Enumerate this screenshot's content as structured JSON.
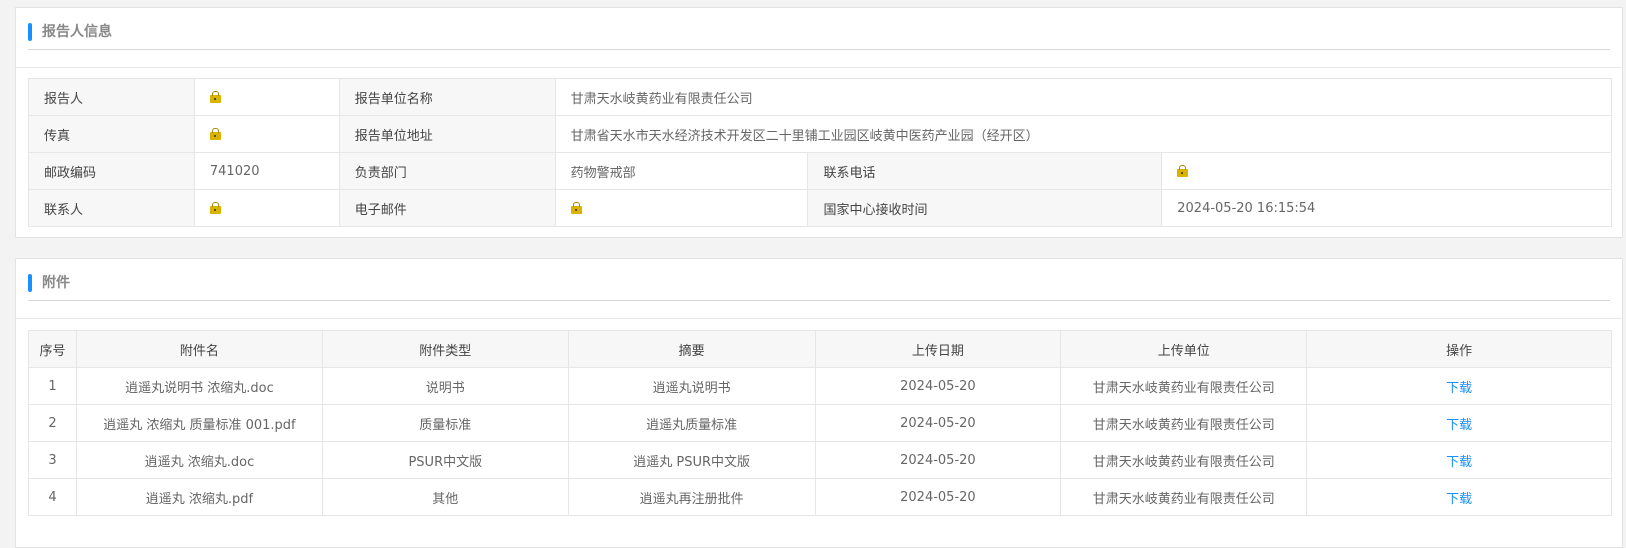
{
  "reporter_section": {
    "title": "报告人信息",
    "rows": [
      {
        "l1": "报告人",
        "v1": "",
        "l2": "报告单位名称",
        "v2": "甘肃天水岐黄药业有限责任公司"
      },
      {
        "l1": "传真",
        "v1": "",
        "l2": "报告单位地址",
        "v2": "甘肃省天水市天水经济技术开发区二十里铺工业园区岐黄中医药产业园（经开区）"
      },
      {
        "l1": "邮政编码",
        "v1": "741020",
        "l2": "负责部门",
        "v2": "药物警戒部",
        "l3": "联系电话",
        "v3": ""
      },
      {
        "l1": "联系人",
        "v1": "",
        "l2": "电子邮件",
        "v2": "",
        "l3": "国家中心接收时间",
        "v3": "2024-05-20 16:15:54"
      }
    ],
    "hidden_value_icon": "lock-icon"
  },
  "attachment_section": {
    "title": "附件",
    "columns": [
      "序号",
      "附件名",
      "附件类型",
      "摘要",
      "上传日期",
      "上传单位",
      "操作"
    ],
    "rows": [
      {
        "no": "1",
        "name": "逍遥丸说明书 浓缩丸.doc",
        "type": "说明书",
        "summary": "逍遥丸说明书",
        "date": "2024-05-20",
        "unit": "甘肃天水岐黄药业有限责任公司",
        "action": "下载"
      },
      {
        "no": "2",
        "name": "逍遥丸 浓缩丸 质量标准 001.pdf",
        "type": "质量标准",
        "summary": "逍遥丸质量标准",
        "date": "2024-05-20",
        "unit": "甘肃天水岐黄药业有限责任公司",
        "action": "下载"
      },
      {
        "no": "3",
        "name": "逍遥丸 浓缩丸.doc",
        "type": "PSUR中文版",
        "summary": "逍遥丸 PSUR中文版",
        "date": "2024-05-20",
        "unit": "甘肃天水岐黄药业有限责任公司",
        "action": "下载"
      },
      {
        "no": "4",
        "name": "逍遥丸 浓缩丸.pdf",
        "type": "其他",
        "summary": "逍遥丸再注册批件",
        "date": "2024-05-20",
        "unit": "甘肃天水岐黄药业有限责任公司",
        "action": "下载"
      }
    ]
  },
  "colors": {
    "accent": "#1890ff",
    "label_bg": "#f7f7f7",
    "lock": "#d8b300"
  }
}
